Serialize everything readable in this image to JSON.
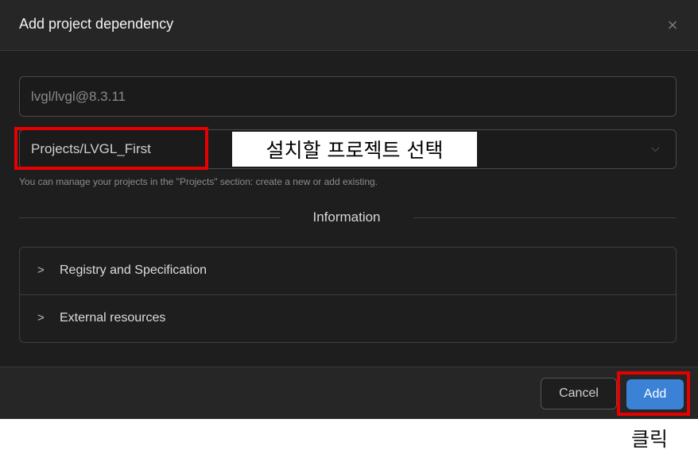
{
  "dialog": {
    "title": "Add project dependency",
    "close_icon": "×",
    "package_input": {
      "value": "lvgl/lvgl@8.3.11",
      "placeholder": ""
    },
    "project_select": {
      "selected": "Projects/LVGL_First",
      "chevron": "⌵"
    },
    "helper_text": "You can manage your projects in the \"Projects\" section: create a new or add existing.",
    "information": {
      "title": "Information",
      "items": [
        {
          "label": "Registry and Specification",
          "chevron": ">"
        },
        {
          "label": "External resources",
          "chevron": ">"
        }
      ]
    },
    "footer": {
      "cancel_label": "Cancel",
      "add_label": "Add"
    }
  },
  "annotations": {
    "select_project": "설치할 프로젝트 선택",
    "click": "클릭",
    "highlight_color": "#e60000"
  },
  "colors": {
    "dialog_bg": "#1e1e1e",
    "header_bg": "#262626",
    "primary_button": "#3b82d6"
  }
}
